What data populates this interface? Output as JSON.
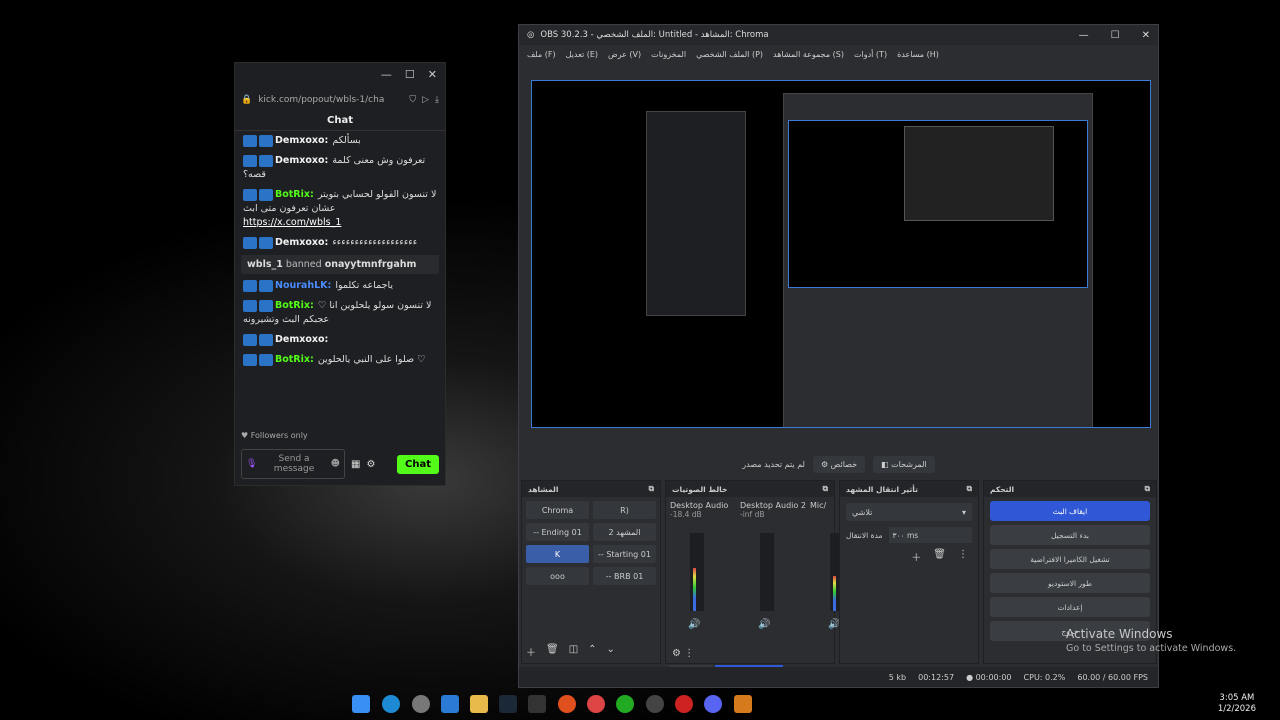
{
  "chat": {
    "url": "kick.com/popout/wbls-1/cha",
    "header": "Chat",
    "messages": [
      {
        "name": "Demxoxo:",
        "name_color": "#f4f4f4",
        "text": "بسألكم"
      },
      {
        "name": "Demxoxo:",
        "name_color": "#f4f4f4",
        "text": "تعرفون وش معنى كلمة قصه؟"
      },
      {
        "name": "BotRix:",
        "name_color": "#53fc18",
        "text": "لا تنسون الفولو لحسابي بتويتر عشان تعرفون متى ابث",
        "link": "https://x.com/wbls_1"
      },
      {
        "name": "Demxoxo:",
        "name_color": "#f4f4f4",
        "text": "ءءءءءءءءءءءءءءءءءءء"
      }
    ],
    "ban_notice": {
      "user": "wbls_1",
      "action": "banned",
      "target": "onayytmnfrgahm"
    },
    "messages2": [
      {
        "name": "NourahLK:",
        "name_color": "#4a8cff",
        "text": "ياجماعه تكلموا"
      },
      {
        "name": "BotRix:",
        "name_color": "#53fc18",
        "text": "لا تنسون سولو يلحلوين انا ♡ عجبكم البث وتشيرونه"
      },
      {
        "name": "Demxoxo:",
        "name_color": "#f4f4f4",
        "text": ""
      },
      {
        "name": "BotRix:",
        "name_color": "#53fc18",
        "text": "صلوا على النبي يالحلوين ♡"
      }
    ],
    "followers_only": "Followers only",
    "send_placeholder": "Send a message",
    "send_button": "Chat"
  },
  "obs": {
    "title": "OBS 30.2.3 - الملف الشخصي: Untitled - المشاهد: Chroma",
    "menu": [
      "ملف (F)",
      "تعديل (E)",
      "عرض (V)",
      "المخزونات",
      "الملف الشخصي (P)",
      "مجموعة المشاهد (S)",
      "أدوات (T)",
      "مساعدة (H)"
    ],
    "no_source": "لم يتم تحديد مصدر",
    "props_button": "خصائص",
    "filters_button": "المرشحات",
    "scenes_title": "المشاهد",
    "scenes": [
      [
        "Chroma",
        "R)"
      ],
      [
        "-- Ending 01",
        "المشهد 2"
      ],
      [
        "K",
        "-- Starting 01"
      ],
      [
        "ooo",
        "-- BRB 01"
      ]
    ],
    "mixer_title": "خالط الصوتيات",
    "channels": [
      {
        "name": "Desktop Audio",
        "db": "-18.4 dB",
        "level": 0.55
      },
      {
        "name": "Desktop Audio 2",
        "db": "-inf dB",
        "level": 0.0
      },
      {
        "name": "Mic/",
        "db": "",
        "level": 0.45
      }
    ],
    "transition_title": "تأثير انتقال المشهد",
    "transition_value": "تلاشي",
    "duration_label": "مدة الانتقال",
    "duration_value": "٣٠٠ ms",
    "controls_title": "التحكم",
    "controls": [
      "ايقاف البث",
      "بدء التسجيل",
      "تشغيل الكاميرا الافتراضية",
      "طور الاستوديو",
      "إعدادات",
      "خروج"
    ],
    "tabs": [
      "المصادر",
      "خالط الصوتيات"
    ],
    "status": {
      "rec": "00:00:00",
      "stream": "00:12:57",
      "cpu": "CPU: 0.2%",
      "fps": "60.00 / 60.00 FPS",
      "kb": "5 kb"
    }
  },
  "watermark": {
    "title": "Activate Windows",
    "sub": "Go to Settings to activate Windows."
  },
  "clock": {
    "time": "3:05 AM",
    "date": "1/2/2026"
  }
}
